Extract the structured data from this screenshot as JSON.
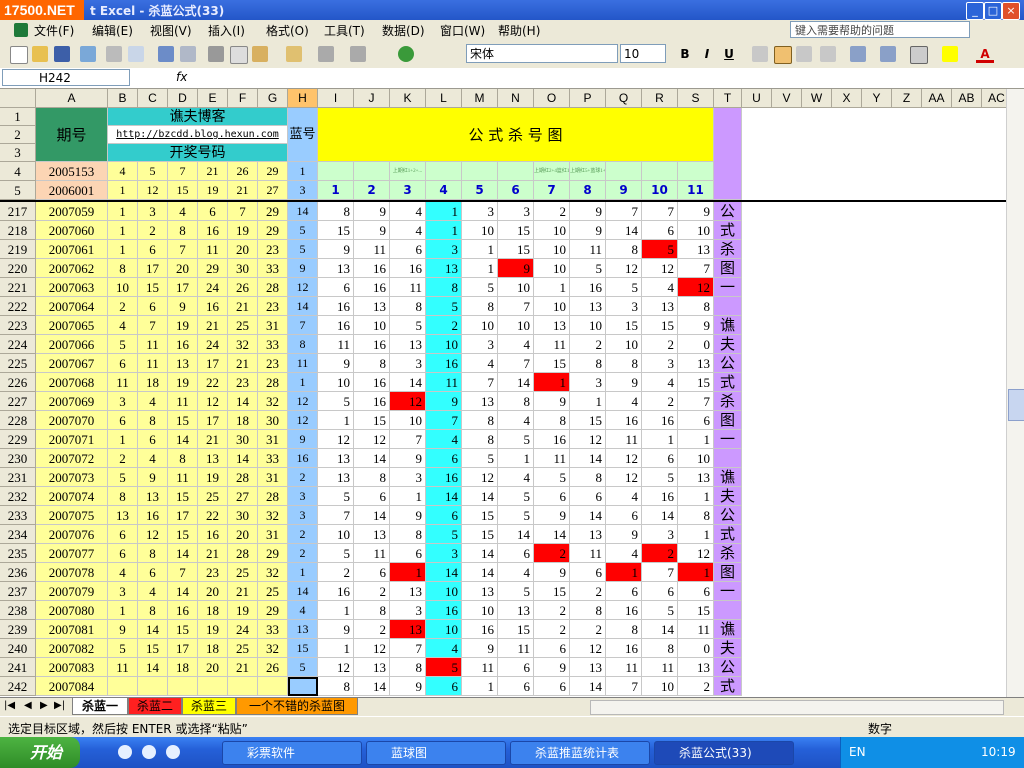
{
  "window": {
    "watermark": "17500.NET",
    "title": "t Excel - 杀蓝公式(33)",
    "btn_min": "_",
    "btn_max": "□",
    "btn_close": "×"
  },
  "menu": {
    "items": [
      "文件(F)",
      "编辑(E)",
      "视图(V)",
      "插入(I)",
      "格式(O)",
      "工具(T)",
      "数据(D)",
      "窗口(W)",
      "帮助(H)"
    ],
    "help_placeholder": "键入需要帮助的问题"
  },
  "toolbar": {
    "font_name": "宋体",
    "font_size": "10",
    "bold": "B",
    "italic": "I",
    "underline": "U",
    "font_color_label": "A"
  },
  "formula_bar": {
    "name_box": "H242",
    "fx": "fx"
  },
  "grid": {
    "columns": [
      "A",
      "B",
      "C",
      "D",
      "E",
      "F",
      "G",
      "H",
      "I",
      "J",
      "K",
      "L",
      "M",
      "N",
      "O",
      "P",
      "Q",
      "R",
      "S",
      "T",
      "U",
      "V",
      "W",
      "X",
      "Y",
      "Z",
      "AA",
      "AB",
      "AC"
    ],
    "header": {
      "period_label": "期号",
      "blog_title": "谯夫博客",
      "blog_url": "http://bzcdd.blog.hexun.com",
      "draw_label": "开奖号码",
      "blue_label": "蓝号",
      "formula_title": "公 式 杀 号 图",
      "formula_index": [
        "1",
        "2",
        "3",
        "4",
        "5",
        "6",
        "7",
        "8",
        "9",
        "10",
        "11"
      ],
      "formula_small_notes": [
        "",
        "",
        "上期红1+2+...",
        "",
        "",
        "",
        "上期红2+4篮红1+1",
        "上期红5+蓝球1+1",
        "",
        "",
        ""
      ]
    },
    "top_rows": [
      {
        "row": "4",
        "period": "2005153",
        "reds": [
          "4",
          "5",
          "7",
          "21",
          "26",
          "29"
        ],
        "blue": "1"
      },
      {
        "row": "5",
        "period": "2006001",
        "reds": [
          "1",
          "12",
          "15",
          "19",
          "21",
          "27"
        ],
        "blue": "3"
      }
    ],
    "rows": [
      {
        "row": "217",
        "period": "2007059",
        "reds": [
          "1",
          "3",
          "4",
          "6",
          "7",
          "29"
        ],
        "blue": "14",
        "kills": [
          "8",
          "9",
          "4",
          "1",
          "3",
          "3",
          "2",
          "9",
          "7",
          "7",
          "9"
        ],
        "hits": [],
        "t": "公"
      },
      {
        "row": "218",
        "period": "2007060",
        "reds": [
          "1",
          "2",
          "8",
          "16",
          "19",
          "29"
        ],
        "blue": "5",
        "kills": [
          "15",
          "9",
          "4",
          "1",
          "10",
          "15",
          "10",
          "9",
          "14",
          "6",
          "10"
        ],
        "hits": [],
        "t": "式"
      },
      {
        "row": "219",
        "period": "2007061",
        "reds": [
          "1",
          "6",
          "7",
          "11",
          "20",
          "23"
        ],
        "blue": "5",
        "kills": [
          "9",
          "11",
          "6",
          "3",
          "1",
          "15",
          "10",
          "11",
          "8",
          "5",
          "13"
        ],
        "hits": [
          9
        ],
        "t": "杀"
      },
      {
        "row": "220",
        "period": "2007062",
        "reds": [
          "8",
          "17",
          "20",
          "29",
          "30",
          "33"
        ],
        "blue": "9",
        "kills": [
          "13",
          "16",
          "16",
          "13",
          "1",
          "9",
          "10",
          "5",
          "12",
          "12",
          "7"
        ],
        "hits": [
          5
        ],
        "t": "图"
      },
      {
        "row": "221",
        "period": "2007063",
        "reds": [
          "10",
          "15",
          "17",
          "24",
          "26",
          "28"
        ],
        "blue": "12",
        "kills": [
          "6",
          "16",
          "11",
          "8",
          "5",
          "10",
          "1",
          "16",
          "5",
          "4",
          "12"
        ],
        "hits": [
          10
        ],
        "t": "一"
      },
      {
        "row": "222",
        "period": "2007064",
        "reds": [
          "2",
          "6",
          "9",
          "16",
          "21",
          "23"
        ],
        "blue": "14",
        "kills": [
          "16",
          "13",
          "8",
          "5",
          "8",
          "7",
          "10",
          "13",
          "3",
          "13",
          "8"
        ],
        "hits": [],
        "t": ""
      },
      {
        "row": "223",
        "period": "2007065",
        "reds": [
          "4",
          "7",
          "19",
          "21",
          "25",
          "31"
        ],
        "blue": "7",
        "kills": [
          "16",
          "10",
          "5",
          "2",
          "10",
          "10",
          "13",
          "10",
          "15",
          "15",
          "9"
        ],
        "hits": [],
        "t": "谯"
      },
      {
        "row": "224",
        "period": "2007066",
        "reds": [
          "5",
          "11",
          "16",
          "24",
          "32",
          "33"
        ],
        "blue": "8",
        "kills": [
          "11",
          "16",
          "13",
          "10",
          "3",
          "4",
          "11",
          "2",
          "10",
          "2",
          "0"
        ],
        "hits": [],
        "t": "夫"
      },
      {
        "row": "225",
        "period": "2007067",
        "reds": [
          "6",
          "11",
          "13",
          "17",
          "21",
          "23"
        ],
        "blue": "11",
        "kills": [
          "9",
          "8",
          "3",
          "16",
          "4",
          "7",
          "15",
          "8",
          "8",
          "3",
          "13"
        ],
        "hits": [],
        "t": "公"
      },
      {
        "row": "226",
        "period": "2007068",
        "reds": [
          "11",
          "18",
          "19",
          "22",
          "23",
          "28"
        ],
        "blue": "1",
        "kills": [
          "10",
          "16",
          "14",
          "11",
          "7",
          "14",
          "1",
          "3",
          "9",
          "4",
          "15"
        ],
        "hits": [
          6
        ],
        "t": "式"
      },
      {
        "row": "227",
        "period": "2007069",
        "reds": [
          "3",
          "4",
          "11",
          "12",
          "14",
          "32"
        ],
        "blue": "12",
        "kills": [
          "5",
          "16",
          "12",
          "9",
          "13",
          "8",
          "9",
          "1",
          "4",
          "2",
          "7"
        ],
        "hits": [
          2
        ],
        "t": "杀"
      },
      {
        "row": "228",
        "period": "2007070",
        "reds": [
          "6",
          "8",
          "15",
          "17",
          "18",
          "30"
        ],
        "blue": "12",
        "kills": [
          "1",
          "15",
          "10",
          "7",
          "8",
          "4",
          "8",
          "15",
          "16",
          "16",
          "6"
        ],
        "hits": [],
        "t": "图"
      },
      {
        "row": "229",
        "period": "2007071",
        "reds": [
          "1",
          "6",
          "14",
          "21",
          "30",
          "31"
        ],
        "blue": "9",
        "kills": [
          "12",
          "12",
          "7",
          "4",
          "8",
          "5",
          "16",
          "12",
          "11",
          "1",
          "1"
        ],
        "hits": [],
        "t": "一"
      },
      {
        "row": "230",
        "period": "2007072",
        "reds": [
          "2",
          "4",
          "8",
          "13",
          "14",
          "33"
        ],
        "blue": "16",
        "kills": [
          "13",
          "14",
          "9",
          "6",
          "5",
          "1",
          "11",
          "14",
          "12",
          "6",
          "10"
        ],
        "hits": [],
        "t": ""
      },
      {
        "row": "231",
        "period": "2007073",
        "reds": [
          "5",
          "9",
          "11",
          "19",
          "28",
          "31"
        ],
        "blue": "2",
        "kills": [
          "13",
          "8",
          "3",
          "16",
          "12",
          "4",
          "5",
          "8",
          "12",
          "5",
          "13"
        ],
        "hits": [],
        "t": "谯"
      },
      {
        "row": "232",
        "period": "2007074",
        "reds": [
          "8",
          "13",
          "15",
          "25",
          "27",
          "28"
        ],
        "blue": "3",
        "kills": [
          "5",
          "6",
          "1",
          "14",
          "14",
          "5",
          "6",
          "6",
          "4",
          "16",
          "1"
        ],
        "hits": [],
        "t": "夫"
      },
      {
        "row": "233",
        "period": "2007075",
        "reds": [
          "13",
          "16",
          "17",
          "22",
          "30",
          "32"
        ],
        "blue": "3",
        "kills": [
          "7",
          "14",
          "9",
          "6",
          "15",
          "5",
          "9",
          "14",
          "6",
          "14",
          "8"
        ],
        "hits": [],
        "t": "公"
      },
      {
        "row": "234",
        "period": "2007076",
        "reds": [
          "6",
          "12",
          "15",
          "16",
          "20",
          "31"
        ],
        "blue": "2",
        "kills": [
          "10",
          "13",
          "8",
          "5",
          "15",
          "14",
          "14",
          "13",
          "9",
          "3",
          "1"
        ],
        "hits": [],
        "t": "式"
      },
      {
        "row": "235",
        "period": "2007077",
        "reds": [
          "6",
          "8",
          "14",
          "21",
          "28",
          "29"
        ],
        "blue": "2",
        "kills": [
          "5",
          "11",
          "6",
          "3",
          "14",
          "6",
          "2",
          "11",
          "4",
          "2",
          "12"
        ],
        "hits": [
          6,
          9
        ],
        "t": "杀"
      },
      {
        "row": "236",
        "period": "2007078",
        "reds": [
          "4",
          "6",
          "7",
          "23",
          "25",
          "32"
        ],
        "blue": "1",
        "kills": [
          "2",
          "6",
          "1",
          "14",
          "14",
          "4",
          "9",
          "6",
          "1",
          "7",
          "1"
        ],
        "hits": [
          2,
          8,
          10
        ],
        "t": "图"
      },
      {
        "row": "237",
        "period": "2007079",
        "reds": [
          "3",
          "4",
          "14",
          "20",
          "21",
          "25"
        ],
        "blue": "14",
        "kills": [
          "16",
          "2",
          "13",
          "10",
          "13",
          "5",
          "15",
          "2",
          "6",
          "6",
          "6"
        ],
        "hits": [],
        "t": "一"
      },
      {
        "row": "238",
        "period": "2007080",
        "reds": [
          "1",
          "8",
          "16",
          "18",
          "19",
          "29"
        ],
        "blue": "4",
        "kills": [
          "1",
          "8",
          "3",
          "16",
          "10",
          "13",
          "2",
          "8",
          "16",
          "5",
          "15"
        ],
        "hits": [],
        "t": ""
      },
      {
        "row": "239",
        "period": "2007081",
        "reds": [
          "9",
          "14",
          "15",
          "19",
          "24",
          "33"
        ],
        "blue": "13",
        "kills": [
          "9",
          "2",
          "13",
          "10",
          "16",
          "15",
          "2",
          "2",
          "8",
          "14",
          "11"
        ],
        "hits": [
          2
        ],
        "t": "谯"
      },
      {
        "row": "240",
        "period": "2007082",
        "reds": [
          "5",
          "15",
          "17",
          "18",
          "25",
          "32"
        ],
        "blue": "15",
        "kills": [
          "1",
          "12",
          "7",
          "4",
          "9",
          "11",
          "6",
          "12",
          "16",
          "8",
          "0"
        ],
        "hits": [],
        "t": "夫"
      },
      {
        "row": "241",
        "period": "2007083",
        "reds": [
          "11",
          "14",
          "18",
          "20",
          "21",
          "26"
        ],
        "blue": "5",
        "kills": [
          "12",
          "13",
          "8",
          "5",
          "11",
          "6",
          "9",
          "13",
          "11",
          "11",
          "13"
        ],
        "hits": [
          3
        ],
        "t": "公"
      },
      {
        "row": "242",
        "period": "2007084",
        "reds": [
          "",
          "",
          "",
          "",
          "",
          ""
        ],
        "blue": "",
        "kills": [
          "8",
          "14",
          "9",
          "6",
          "1",
          "6",
          "6",
          "14",
          "7",
          "10",
          "2"
        ],
        "hits": [],
        "t": "式"
      }
    ]
  },
  "tabs": [
    {
      "label": "杀蓝一",
      "color": "#ffffff"
    },
    {
      "label": "杀蓝二",
      "color": "#ff2020"
    },
    {
      "label": "杀蓝三",
      "color": "#ffff00"
    },
    {
      "label": "一个不错的杀蓝图",
      "color": "#ff9900"
    }
  ],
  "status": {
    "message": "选定目标区域，然后按 ENTER 或选择“粘贴”",
    "mode": "数字"
  },
  "taskbar": {
    "start": "开始",
    "tasks": [
      "彩票软件",
      "蓝球图",
      "杀蓝推蓝统计表",
      "杀蓝公式(33)"
    ],
    "lang": "EN",
    "clock": "10:19"
  },
  "colors": {
    "period_bg": "#ffff99",
    "top_period_bg": "#fcd5b4",
    "blog_bg": "#33cccc",
    "header_green": "#339966",
    "blue_col": "#99ccff",
    "formula_bg": "#ffff00",
    "formula_index_bg": "#ccffcc",
    "formula_index_fg": "#0000cc",
    "col_l_highlight": "#33ffff",
    "hit_red": "#ff0000",
    "t_col": "#cc99ff"
  }
}
